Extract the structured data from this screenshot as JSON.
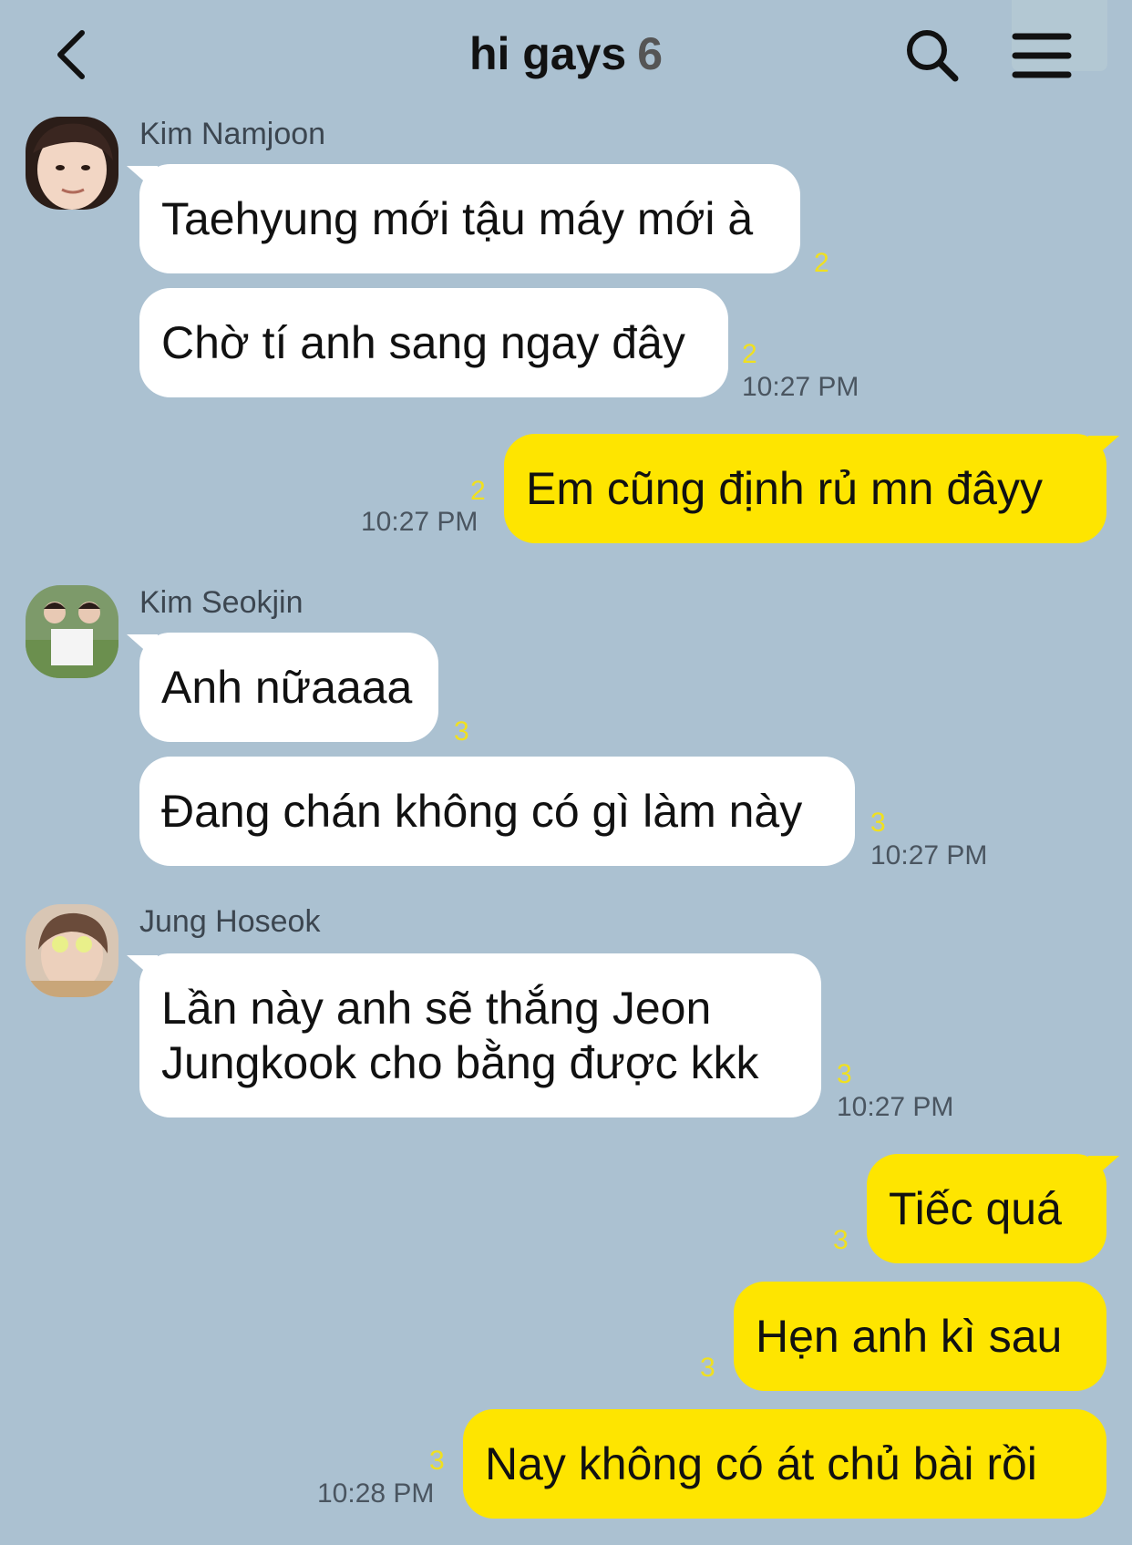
{
  "header": {
    "title": "hi gays",
    "member_count": "6",
    "back_icon": "chevron-left-icon",
    "search_icon": "search-icon",
    "menu_icon": "hamburger-menu-icon"
  },
  "messages": [
    {
      "sender": "Kim Namjoon",
      "text": "Taehyung mới tậu máy mới à",
      "unread": "2",
      "time": ""
    },
    {
      "sender": "",
      "text": "Chờ tí anh sang ngay đây",
      "unread": "2",
      "time": "10:27 PM"
    },
    {
      "sender": "me",
      "text": "Em cũng định rủ mn đâyy",
      "unread": "2",
      "time": "10:27 PM"
    },
    {
      "sender": "Kim Seokjin",
      "text": "Anh nữaaaa",
      "unread": "3",
      "time": ""
    },
    {
      "sender": "",
      "text": "Đang chán không có gì làm này",
      "unread": "3",
      "time": "10:27 PM"
    },
    {
      "sender": "Jung Hoseok",
      "text": "Lần này anh sẽ thắng Jeon Jungkook cho bằng được kkk",
      "unread": "3",
      "time": "10:27 PM"
    },
    {
      "sender": "me",
      "text": "Tiếc quá",
      "unread": "3",
      "time": ""
    },
    {
      "sender": "me",
      "text": "Hẹn anh kì sau",
      "unread": "3",
      "time": ""
    },
    {
      "sender": "me",
      "text": "Nay không có át chủ bài rồi",
      "unread": "3",
      "time": "10:28 PM"
    }
  ],
  "colors": {
    "background": "#abc1d1",
    "my_bubble": "#fee500",
    "their_bubble": "#ffffff",
    "unread_count": "#f0e020"
  }
}
